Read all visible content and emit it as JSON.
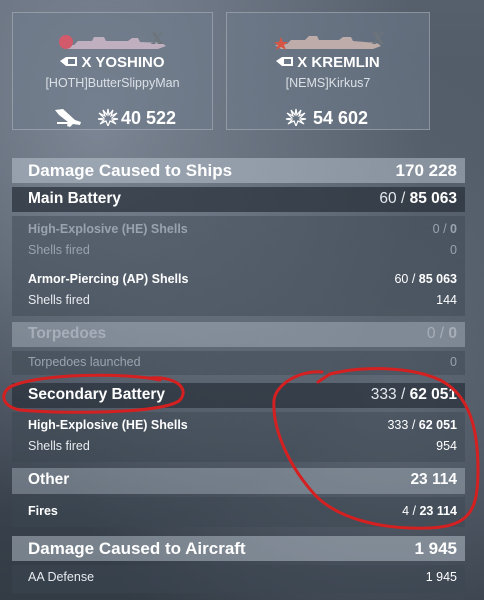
{
  "players": [
    {
      "ship_name": "X YOSHINO",
      "player": "[HOTH]ButterSlippyMan",
      "damage": "40 522",
      "tier_icon": "tier-x-emblem",
      "has_plane_icon": true
    },
    {
      "ship_name": "X KREMLIN",
      "player": "[NEMS]Kirkus7",
      "damage": "54 602",
      "tier_icon": "tier-x-emblem",
      "has_plane_icon": false
    }
  ],
  "damage_to_ships": {
    "label": "Damage Caused to Ships",
    "value": "170 228"
  },
  "main_battery": {
    "label": "Main Battery",
    "hits": "60",
    "sep": " / ",
    "damage": "85 063",
    "he": {
      "label": "High-Explosive (HE) Shells",
      "hits": "0",
      "sep": " / ",
      "damage": "0",
      "fired_label": "Shells fired",
      "fired": "0"
    },
    "ap": {
      "label": "Armor-Piercing (AP) Shells",
      "hits": "60",
      "sep": " / ",
      "damage": "85 063",
      "fired_label": "Shells fired",
      "fired": "144"
    }
  },
  "torpedoes": {
    "label": "Torpedoes",
    "hits": "0",
    "sep": " / ",
    "damage": "0",
    "launched_label": "Torpedoes launched",
    "launched": "0"
  },
  "secondary": {
    "label": "Secondary Battery",
    "hits": "333",
    "sep": " / ",
    "damage": "62 051",
    "he": {
      "label": "High-Explosive (HE) Shells",
      "hits": "333",
      "sep": " / ",
      "damage": "62 051",
      "fired_label": "Shells fired",
      "fired": "954"
    }
  },
  "other": {
    "label": "Other",
    "value": "23 114",
    "fires": {
      "label": "Fires",
      "hits": "4",
      "sep": " / ",
      "damage": "23 114"
    }
  },
  "damage_to_aircraft": {
    "label": "Damage Caused to Aircraft",
    "value": "1 945",
    "aa": {
      "label": "AA Defense",
      "value": "1 945"
    }
  },
  "colors": {
    "annotation": "#d42020",
    "header_band": "#aab4c0",
    "dim_text": "#9aa2ad"
  }
}
